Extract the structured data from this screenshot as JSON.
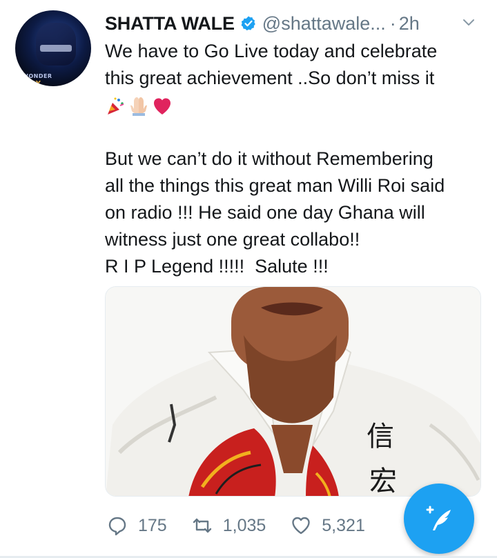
{
  "tweet": {
    "display_name": "SHATTA WALE",
    "handle": "@shattawale...",
    "separator": "·",
    "time": "2h",
    "avatar_watermark_line1": "WONDER",
    "avatar_watermark_line2": "BOY",
    "text_line1": "We have to Go Live today and celebrate",
    "text_line2": "this great achievement ..So don’t miss it",
    "emojis": [
      "party-popper",
      "folded-hands",
      "red-heart"
    ],
    "text_paragraph2": "But we can’t do it without Remembering\nall the things this great man Willi Roi said\non radio !!! He said one day Ghana will\nwitness just one great collabo!!\nR I P Legend !!!!!  Salute !!!",
    "media_description_icon": "photo-of-man-in-printed-shirt",
    "media_shirt_text": "信 宏"
  },
  "actions": {
    "replies": "175",
    "retweets": "1,035",
    "likes": "5,321"
  },
  "colors": {
    "brand_blue": "#1da1f2",
    "secondary_text": "#657786",
    "primary_text": "#14171a"
  },
  "icons": {
    "verified": "verified-badge-icon",
    "chevron": "chevron-down-icon",
    "reply": "reply-icon",
    "retweet": "retweet-icon",
    "like": "heart-icon",
    "compose": "compose-tweet-icon"
  }
}
